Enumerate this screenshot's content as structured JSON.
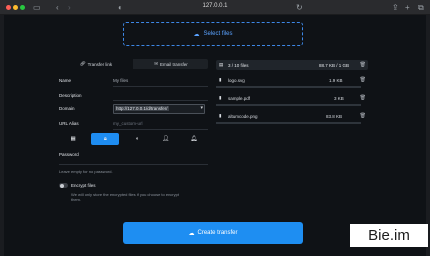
{
  "browser": {
    "url": "127.0.0.1"
  },
  "select_files": {
    "label": "Select files"
  },
  "tabs": [
    {
      "label": "Transfer link",
      "active": true
    },
    {
      "label": "Email transfer",
      "active": false
    }
  ],
  "form": {
    "name_label": "Name",
    "name_value": "My files",
    "description_label": "Description",
    "domain_label": "Domain",
    "domain_value": "http://127.0.0.1/d/transfer/",
    "url_alias_label": "URL Alias",
    "url_alias_placeholder": "my_custom-url",
    "password_label": "Password",
    "password_hint": "Leave empty for no password.",
    "encrypt_label": "Encrypt files",
    "encrypt_hint_line1": "We will only store the encrypted files if you choose to encrypt",
    "encrypt_hint_line2": "them.",
    "encrypt_enabled": false
  },
  "option_icons": [
    "calendar-icon",
    "lock-icon",
    "contrast-icon",
    "user-icon",
    "bell-icon"
  ],
  "files_summary": {
    "count": "3 / 10 files",
    "size": "88.7 KB / 1 GB"
  },
  "files": [
    {
      "name": "logo.svg",
      "size": "1.9 KB"
    },
    {
      "name": "sample.pdf",
      "size": "3 KB"
    },
    {
      "name": "altumcode.png",
      "size": "83.8 KB"
    }
  ],
  "create_button": {
    "label": "Create transfer"
  },
  "watermark": "Bie.im",
  "colors": {
    "accent": "#1e8ef2",
    "background": "#0f1216"
  }
}
